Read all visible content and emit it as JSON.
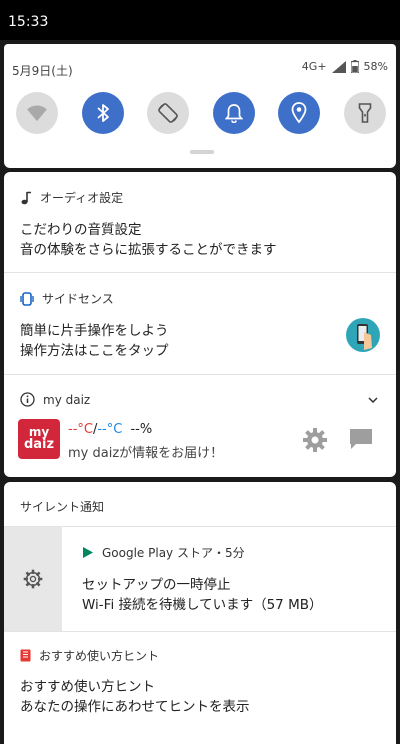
{
  "status_bar": {
    "time": "15:33"
  },
  "quick_settings": {
    "date": "5月9日(土)",
    "network": "4G+",
    "battery": "58%",
    "tiles": [
      {
        "name": "wifi",
        "state": "off"
      },
      {
        "name": "bluetooth",
        "state": "on"
      },
      {
        "name": "auto-rotate",
        "state": "off"
      },
      {
        "name": "sound",
        "state": "on"
      },
      {
        "name": "location",
        "state": "on"
      },
      {
        "name": "flashlight",
        "state": "off"
      }
    ]
  },
  "notifications": {
    "audio": {
      "app": "オーディオ設定",
      "title": "こだわりの音質設定",
      "text": "音の体験をさらに拡張することができます"
    },
    "side_sense": {
      "app": "サイドセンス",
      "title": "簡単に片手操作をしよう",
      "text": "操作方法はここをタップ"
    },
    "my_daiz": {
      "app": "my daiz",
      "logo_line1": "my",
      "logo_line2": "daiz",
      "temp_high": "--°C",
      "slash": "/",
      "temp_low": "--°C",
      "humidity": "--%",
      "message": "my daizが情報をお届け！"
    }
  },
  "silent": {
    "header": "サイレント通知",
    "google_play": {
      "app": "Google Play ストア・5分",
      "title": "セットアップの一時停止",
      "text": "Wi-Fi 接続を待機しています（57 MB）"
    },
    "tips": {
      "app": "おすすめ使い方ヒント",
      "title": "おすすめ使い方ヒント",
      "text": "あなたの操作にあわせてヒントを表示"
    }
  },
  "colors": {
    "tile_on": "#3e6fc9",
    "tile_off": "#dcdcdc",
    "daiz_red": "#d2273a",
    "play_green": "#01875f",
    "temp_red": "#e53935",
    "temp_blue": "#1e88e5"
  }
}
